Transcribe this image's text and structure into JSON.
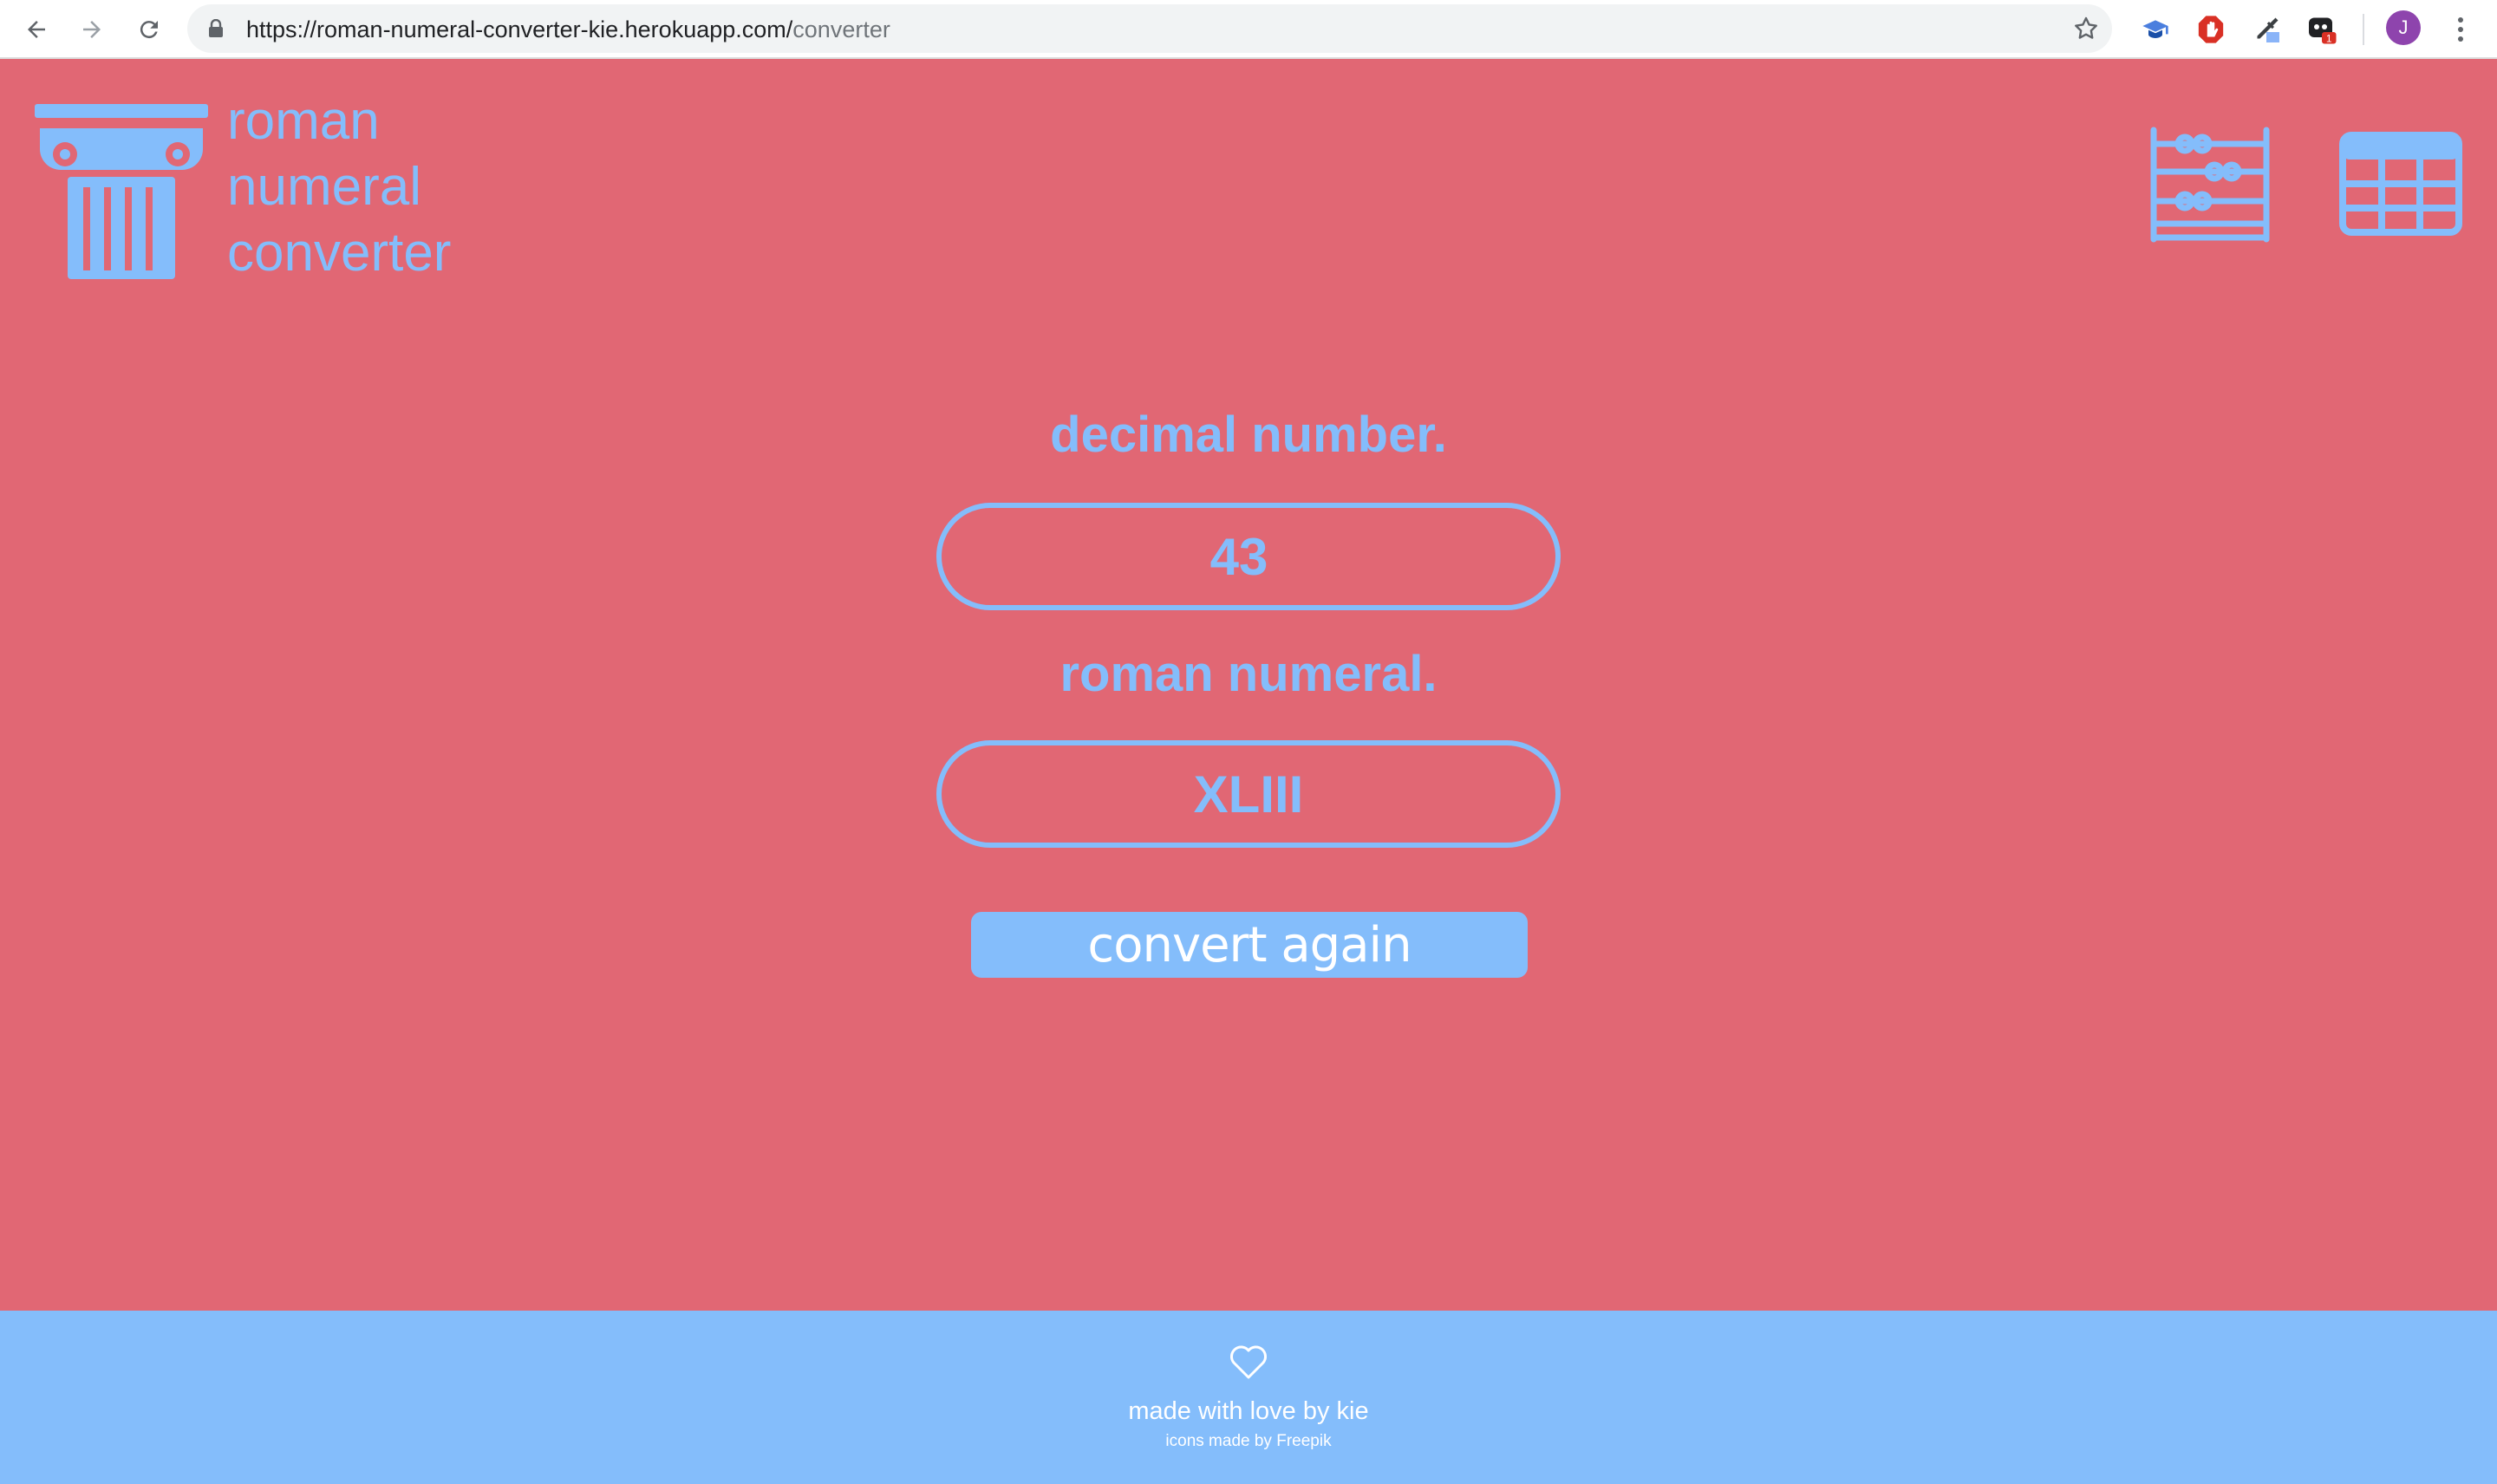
{
  "browser": {
    "url_host": "https://roman-numeral-converter-kie.herokuapp.com/",
    "url_path": "converter",
    "profile_initial": "J",
    "extension_badge": "1"
  },
  "brand": {
    "line1": "roman",
    "line2": "numeral",
    "line3": "converter"
  },
  "header_icons": [
    "abacus-icon",
    "table-icon"
  ],
  "converter": {
    "decimal_label": "decimal number.",
    "decimal_value": "43",
    "roman_label": "roman numeral.",
    "roman_value": "XLIII",
    "button_label": "convert again"
  },
  "footer": {
    "credit": "made with love by kie",
    "icons_credit": "icons made by Freepik"
  },
  "colors": {
    "background": "#e16774",
    "accent": "#84bdfb",
    "white": "#ffffff"
  }
}
